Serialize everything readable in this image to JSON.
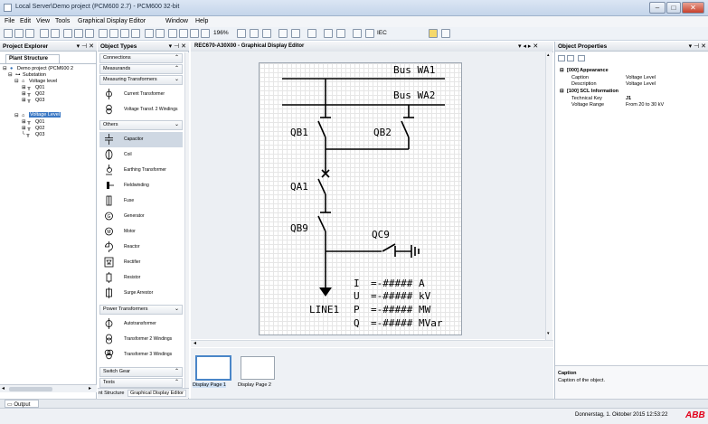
{
  "window": {
    "title": "Local Server\\Demo project (PCM600 2.7) - PCM600 32-bit",
    "minimize": "–",
    "maximize": "□",
    "close": "✕"
  },
  "menu": [
    "File",
    "Edit",
    "View",
    "Tools",
    "Graphical Display Editor",
    "Window",
    "Help"
  ],
  "toolbar": {
    "zoom": "196%",
    "iec_label": "IEC"
  },
  "project_explorer": {
    "title": "Project Explorer",
    "pins": "▾ ⊣ ✕",
    "tab": "Plant Structure",
    "tree": [
      {
        "label": "Demo project (PCM600 2"
      },
      {
        "label": "Substation"
      },
      {
        "label": "Voltage level"
      },
      {
        "label": "Q01"
      },
      {
        "label": "Q02"
      },
      {
        "label": "Q03"
      },
      {
        "label": "Voltage Level"
      },
      {
        "label": "Q01"
      },
      {
        "label": "Q02"
      },
      {
        "label": "Q03"
      }
    ],
    "bottom_tabs": [
      "nt Structure",
      "Graphical Display Editor"
    ]
  },
  "object_types": {
    "title": "Object Types",
    "pins": "▾ ⊣ ✕",
    "groups_top": [
      {
        "label": "Connections",
        "chevron": "⌃"
      },
      {
        "label": "Measurands",
        "chevron": "⌃"
      },
      {
        "label": "Measuring Transformers",
        "chevron": "⌄"
      }
    ],
    "measuring_items": [
      {
        "label": "Current Transformer",
        "icon": "current-transformer-icon"
      },
      {
        "label": "Voltage Transf. 2 Windings",
        "icon": "voltage-transformer-icon"
      }
    ],
    "others_group": {
      "label": "Others",
      "chevron": "⌄"
    },
    "others_items": [
      {
        "label": "Capacitor"
      },
      {
        "label": "Coil"
      },
      {
        "label": "Earthing Transformer"
      },
      {
        "label": "Fieldwinding"
      },
      {
        "label": "Fuse"
      },
      {
        "label": "Generator"
      },
      {
        "label": "Motor"
      },
      {
        "label": "Reactor"
      },
      {
        "label": "Rectifier"
      },
      {
        "label": "Resistor"
      },
      {
        "label": "Surge Arrestor"
      }
    ],
    "power_group": {
      "label": "Power Transformers",
      "chevron": "⌄"
    },
    "power_items": [
      {
        "label": "Autotransformer"
      },
      {
        "label": "Transformer 2 Windings"
      },
      {
        "label": "Transformer 3 Windings"
      }
    ],
    "groups_bottom": [
      {
        "label": "Switch Gear",
        "chevron": "⌃"
      },
      {
        "label": "Texts",
        "chevron": "⌃"
      }
    ]
  },
  "editor": {
    "tab": "REC670-A30X00 - Graphical Display Editor",
    "tab_controls": "▾ ◂ ▸ ✕",
    "page_tabs": [
      "Display Page 1",
      "Display Page 2"
    ]
  },
  "diagram": {
    "bus1": "Bus WA1",
    "bus2": "Bus WA2",
    "qb1": "QB1",
    "qb2": "QB2",
    "qa1": "QA1",
    "qb9": "QB9",
    "qc9": "QC9",
    "line": "LINE1",
    "measurements": [
      {
        "q": "I",
        "v": "=-##### A"
      },
      {
        "q": "U",
        "v": "=-##### kV"
      },
      {
        "q": "P",
        "v": "=-##### MW"
      },
      {
        "q": "Q",
        "v": "=-##### MVar"
      }
    ]
  },
  "object_properties": {
    "title": "Object Properties",
    "pins": "▾ ⊣ ✕",
    "sections": [
      {
        "header": "[000] Appearance",
        "rows": [
          {
            "key": "Caption",
            "value": "Voltage Level"
          },
          {
            "key": "Description",
            "value": "Voltage Level"
          }
        ]
      },
      {
        "header": "[100] SCL Information",
        "rows": [
          {
            "key": "Technical Key",
            "value": "J1"
          },
          {
            "key": "Voltage Range",
            "value": "From 20 to 30 kV"
          }
        ]
      }
    ],
    "help_title": "Caption",
    "help_text": "Caption of the object."
  },
  "output_tab": "Output",
  "status": {
    "datetime": "Donnerstag, 1. Oktober 2015 12:53:22",
    "logo": "ABB",
    "logo_color": "#e2001a"
  }
}
